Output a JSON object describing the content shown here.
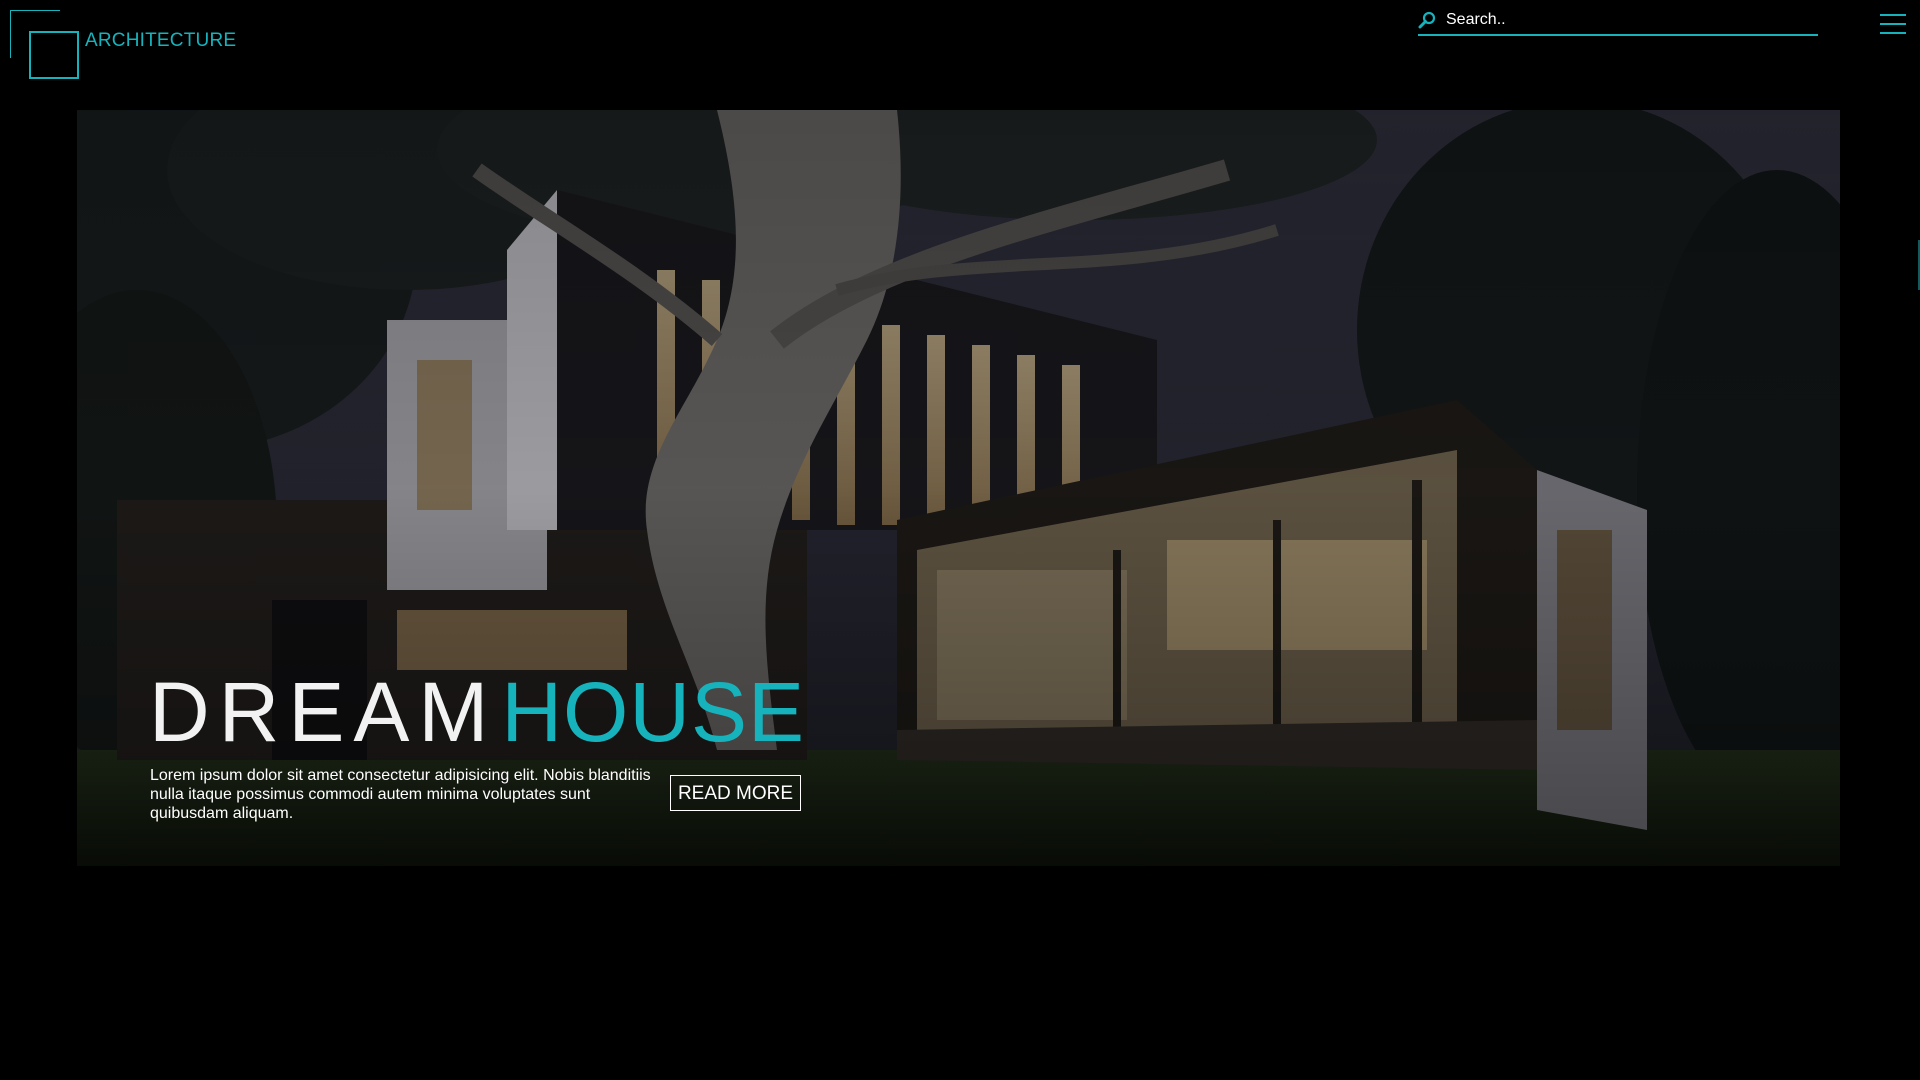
{
  "brand": {
    "name": "ARCHITECTURE",
    "accent_color": "#17b3bd",
    "logo_icon": "double-square-logo-icon"
  },
  "search": {
    "placeholder": "Search..",
    "icon": "search-icon"
  },
  "menu": {
    "icon": "hamburger-menu-icon"
  },
  "hero": {
    "image": "modern-house-at-night-photo",
    "title_word_1": "DREAM",
    "title_word_2": "HOUSE",
    "description": "Lorem ipsum dolor sit amet consectetur adipisicing elit. Nobis blanditiis nulla itaque possimus commodi autem minima voluptates sunt quibusdam aliquam.",
    "cta_label": "READ MORE"
  }
}
